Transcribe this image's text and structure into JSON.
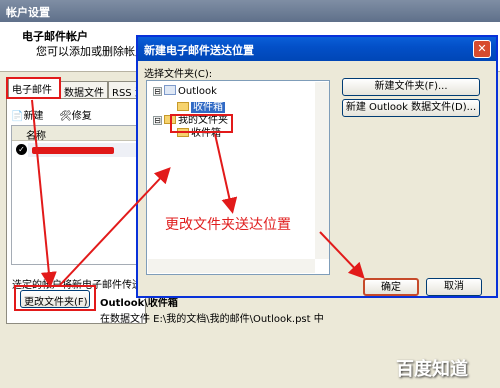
{
  "back_dialog": {
    "title": "帐户设置",
    "section_title": "电子邮件帐户",
    "section_desc": "您可以添加或删除帐户。",
    "tabs": [
      "电子邮件",
      "数据文件",
      "RSS 源"
    ],
    "toolbar": {
      "new_label": "新建",
      "repair_label": "修复"
    },
    "list_header": "名称",
    "selected_text": "选定的帐户将新电子邮件传送",
    "change_folder_label": "更改文件夹(F)",
    "outlook_inbox": "Outlook\\收件箱",
    "data_file_path": "在数据文件 E:\\我的文档\\我的邮件\\Outlook.pst 中"
  },
  "front_dialog": {
    "title": "新建电子邮件送达位置",
    "close_glyph": "✕",
    "select_folder_label": "选择文件夹(C):",
    "tree": [
      {
        "label": "Outlook",
        "expander": "⊟"
      },
      {
        "label": "收件箱"
      },
      {
        "label": "我的文件夹",
        "expander": "⊟"
      },
      {
        "label": "收件箱"
      }
    ],
    "new_folder_label": "新建文件夹(F)...",
    "new_data_file_label": "新建 Outlook 数据文件(D)...",
    "ok_label": "确定",
    "cancel_label": "取消"
  },
  "annotation": {
    "text": "更改文件夹送达位置",
    "color": "#e02020"
  },
  "watermark": "百度知道",
  "icons": [
    "new-icon",
    "repair-icon",
    "check-icon",
    "folder-icon",
    "outlook-icon",
    "close-icon"
  ]
}
